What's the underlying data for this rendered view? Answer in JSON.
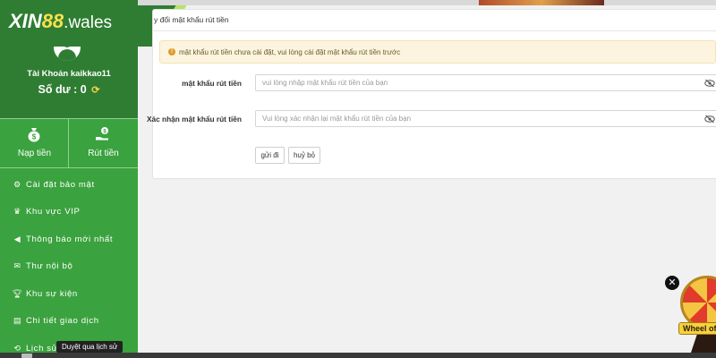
{
  "brand": {
    "xin": "XIN",
    "num": "88",
    "domain": ".wales"
  },
  "sidebar": {
    "account_label": "Tài Khoản kaikkao11",
    "balance_label": "Số dư : 0",
    "deposit_label": "Nạp tiền",
    "withdraw_label": "Rút tiền",
    "menu": [
      {
        "label": "Cài đặt bảo mật",
        "icon": "user-gear-icon"
      },
      {
        "label": "Khu vực VIP",
        "icon": "crown-icon"
      },
      {
        "label": "Thông báo mới nhất",
        "icon": "megaphone-icon"
      },
      {
        "label": "Thư nội bộ",
        "icon": "envelope-icon"
      },
      {
        "label": "Khu sự kiện",
        "icon": "trophy-icon"
      },
      {
        "label": "Chi tiết giao dịch",
        "icon": "clipboard-icon"
      },
      {
        "label": "Lịch sử",
        "icon": "history-icon"
      }
    ]
  },
  "panel": {
    "title": "y đổi mật khẩu rút tiền",
    "alert": "mật khẩu rút tiền chưa cài đặt, vui lòng cài đặt mật khẩu rút tiền trước",
    "fields": [
      {
        "label": "mật khẩu rút tiền",
        "placeholder": "vui lòng nhập mật khẩu rút tiền của bạn"
      },
      {
        "label": "Xác nhận mật khẩu rút tiền",
        "placeholder": "Vui lòng xác nhận lại mật khẩu rút tiền của bạn"
      }
    ],
    "submit_label": "gửi đi",
    "cancel_label": "huỷ bỏ"
  },
  "widget": {
    "wheel_label": "Wheel of",
    "close_glyph": "✕"
  },
  "tooltip": "Duyệt qua lịch sử",
  "colors": {
    "sidebar": "#3aa23e",
    "sidebar_dark": "#2f7d33",
    "accent_lime": "#b5e36a",
    "alert_bg": "#fcf4de"
  }
}
